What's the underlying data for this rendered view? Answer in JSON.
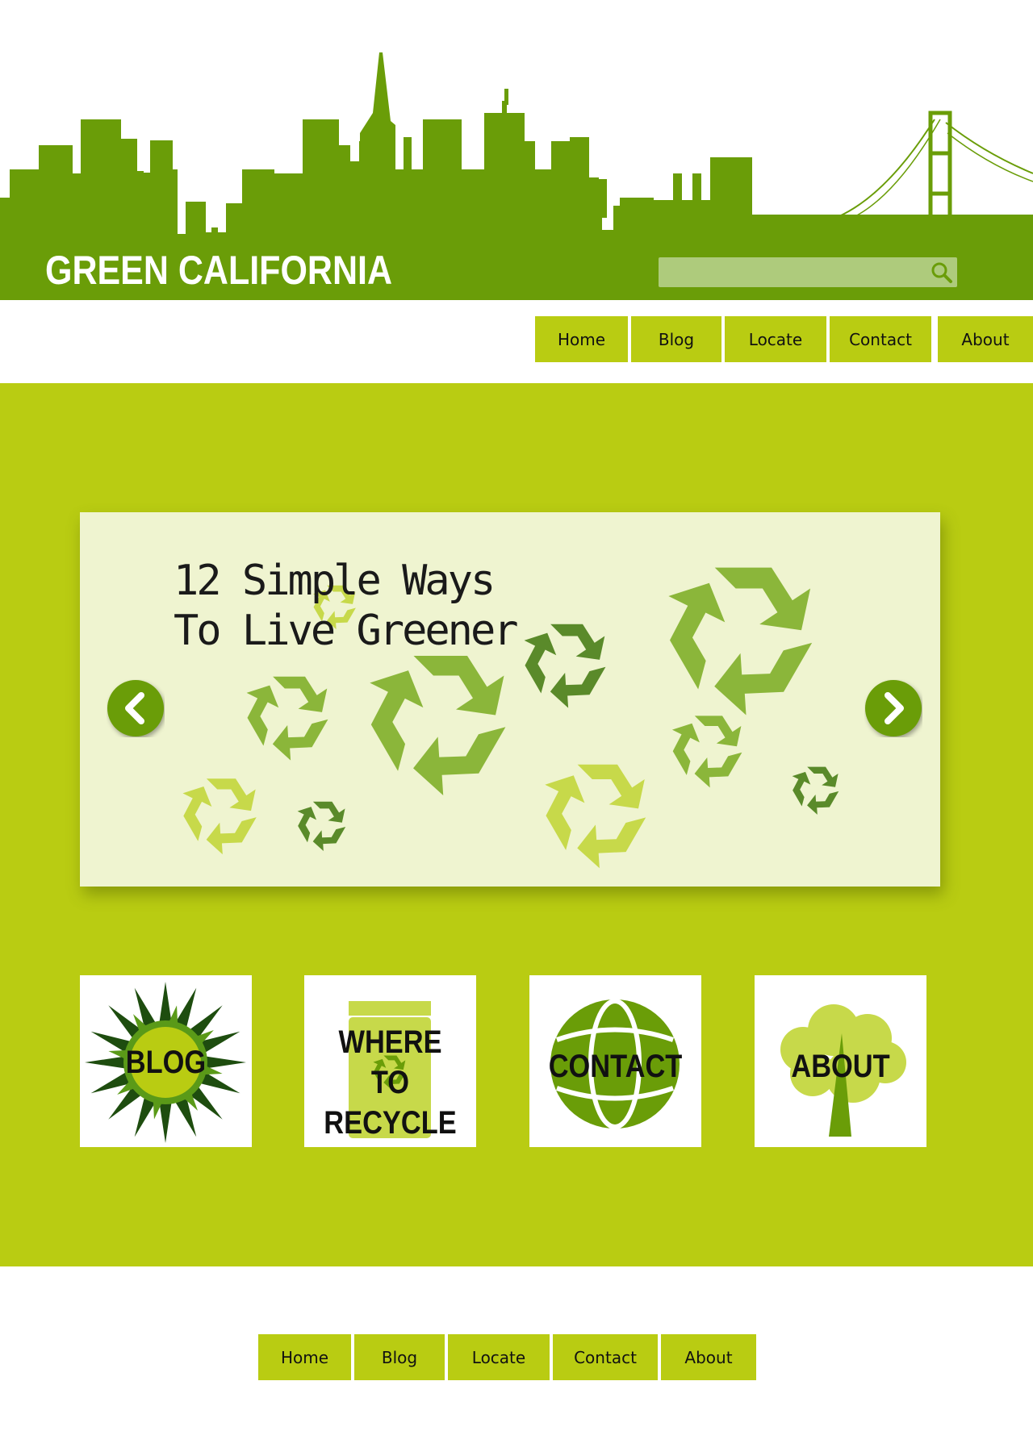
{
  "header": {
    "title": "GREEN CALIFORNIA",
    "search": {
      "placeholder": "",
      "value": "",
      "icon": "search-icon"
    }
  },
  "nav": {
    "items": [
      {
        "label": "Home"
      },
      {
        "label": "Blog"
      },
      {
        "label": "Locate"
      },
      {
        "label": "Contact"
      },
      {
        "label": "About"
      }
    ]
  },
  "slider": {
    "title_line1": "12 Simple Ways",
    "title_line2": "To Live Greener",
    "prev_icon": "chevron-left-icon",
    "next_icon": "chevron-right-icon"
  },
  "tiles": [
    {
      "label": "BLOG",
      "icon": "sunburst-icon"
    },
    {
      "label_line1": "WHERE TO",
      "label_line2": "RECYCLE",
      "icon": "recycle-bin-icon"
    },
    {
      "label": "CONTACT",
      "icon": "globe-icon"
    },
    {
      "label": "ABOUT",
      "icon": "tree-icon"
    }
  ],
  "footer_nav": {
    "items": [
      {
        "label": "Home"
      },
      {
        "label": "Blog"
      },
      {
        "label": "Locate"
      },
      {
        "label": "Contact"
      },
      {
        "label": "About"
      }
    ]
  },
  "colors": {
    "header_green": "#6a9d08",
    "lime": "#b9cc12",
    "slide_background": "#eff4d0",
    "recycle_dark": "#5a8a2a",
    "recycle_mid": "#8bb63a",
    "recycle_light": "#c7d94a"
  }
}
